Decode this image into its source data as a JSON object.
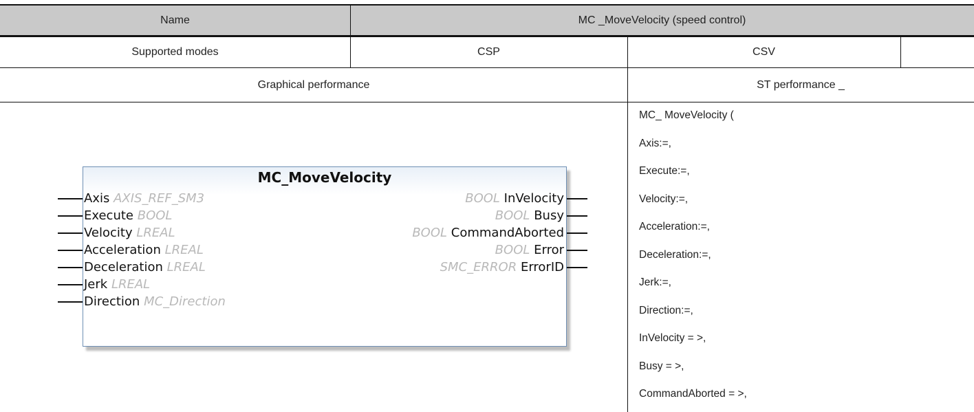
{
  "table": {
    "row1": {
      "name_label": "Name",
      "function_name": "MC _MoveVelocity (speed control)"
    },
    "row2": {
      "modes_label": "Supported modes",
      "mode1": "CSP",
      "mode2": "CSV",
      "mode3": ""
    },
    "row3": {
      "graphical_label": "Graphical performance",
      "st_label": "ST performance _"
    }
  },
  "function_block": {
    "title": "MC_MoveVelocity",
    "inputs": [
      {
        "name": "Axis",
        "type": "AXIS_REF_SM3"
      },
      {
        "name": "Execute",
        "type": "BOOL"
      },
      {
        "name": "Velocity",
        "type": "LREAL"
      },
      {
        "name": "Acceleration",
        "type": "LREAL"
      },
      {
        "name": "Deceleration",
        "type": "LREAL"
      },
      {
        "name": "Jerk",
        "type": "LREAL"
      },
      {
        "name": "Direction",
        "type": "MC_Direction"
      }
    ],
    "outputs": [
      {
        "name": "InVelocity",
        "type": "BOOL"
      },
      {
        "name": "Busy",
        "type": "BOOL"
      },
      {
        "name": "CommandAborted",
        "type": "BOOL"
      },
      {
        "name": "Error",
        "type": "BOOL"
      },
      {
        "name": "ErrorID",
        "type": "SMC_ERROR"
      }
    ]
  },
  "st_code": [
    "MC_ MoveVelocity (",
    "Axis:=,",
    "Execute:=,",
    "Velocity:=,",
    "Acceleration:=,",
    "Deceleration:=,",
    "Jerk:=,",
    "Direction:=,",
    "InVelocity = >,",
    "Busy = >,",
    "CommandAborted = >,"
  ]
}
